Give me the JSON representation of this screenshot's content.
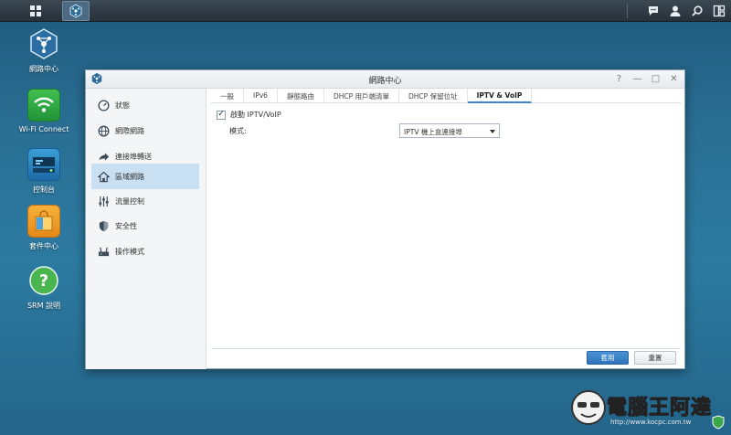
{
  "window": {
    "title": "網路中心",
    "controls": [
      "?",
      "—",
      "□",
      "✕"
    ]
  },
  "desktop": {
    "icons": [
      {
        "label": "網路中心"
      },
      {
        "label": "Wi-Fi Connect"
      },
      {
        "label": "控制台"
      },
      {
        "label": "套件中心"
      },
      {
        "label": "SRM 說明"
      }
    ]
  },
  "sidebar": {
    "items": [
      {
        "label": "狀態",
        "icon": "gauge-icon"
      },
      {
        "label": "網際網路",
        "icon": "globe-icon"
      },
      {
        "label": "連接埠轉送",
        "icon": "arrow-forward-icon"
      },
      {
        "label": "區域網路",
        "icon": "home-network-icon",
        "active": true
      },
      {
        "label": "流量控制",
        "icon": "sliders-icon"
      },
      {
        "label": "安全性",
        "icon": "shield-icon"
      },
      {
        "label": "操作模式",
        "icon": "router-icon"
      }
    ]
  },
  "tabs": [
    {
      "label": "一般"
    },
    {
      "label": "IPv6"
    },
    {
      "label": "靜態路由"
    },
    {
      "label": "DHCP 用戶端清單"
    },
    {
      "label": "DHCP 保留位址"
    },
    {
      "label": "IPTV & VoIP",
      "active": true
    }
  ],
  "form": {
    "enable_label": "啟動 IPTV/VoIP",
    "enable_checked": true,
    "mode_label": "模式:",
    "mode_value": "IPTV 機上盒連接埠"
  },
  "buttons": {
    "apply": "套用",
    "reset": "重置"
  },
  "watermark": {
    "text": "電腦王阿達",
    "url": "http://www.kocpc.com.tw"
  },
  "colors": {
    "accent": "#3e86c8",
    "active_side": "#c9dff2"
  }
}
